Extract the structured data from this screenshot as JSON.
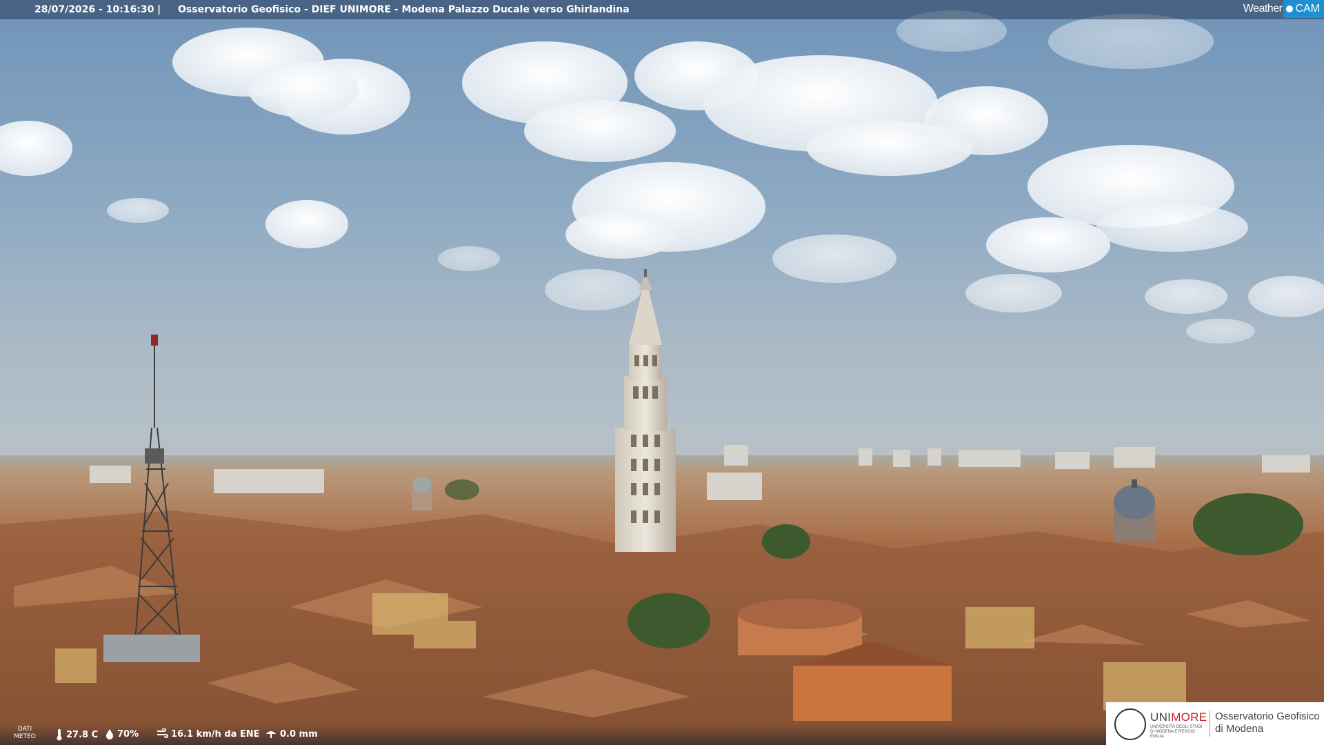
{
  "overlay": {
    "timestamp": "28/07/2026 - 10:16:30",
    "separator": "|",
    "title": "Osservatorio Geofisico - DIEF UNIMORE - Modena Palazzo Ducale verso Ghirlandina"
  },
  "brand_logo": {
    "weather": "Weather",
    "cam": "CAM",
    "accent_color": "#1e8fd0"
  },
  "meteo": {
    "label_line1": "DATI",
    "label_line2": "METEO",
    "temperature": "27.8 C",
    "humidity": "70%",
    "wind": "16.1 km/h da ENE",
    "rain": "0.0 mm",
    "icons": [
      "thermometer-icon",
      "humidity-drop-icon",
      "wind-icon",
      "rain-icon"
    ]
  },
  "institution_logo": {
    "uni": "UNI",
    "more": "MORE",
    "subtitle": "UNIVERSITÀ DEGLI STUDI DI MODENA E REGGIO EMILIA",
    "observatory_line1": "Osservatorio Geofisico",
    "observatory_line2": "di Modena",
    "accent_color": "#c8202d"
  }
}
